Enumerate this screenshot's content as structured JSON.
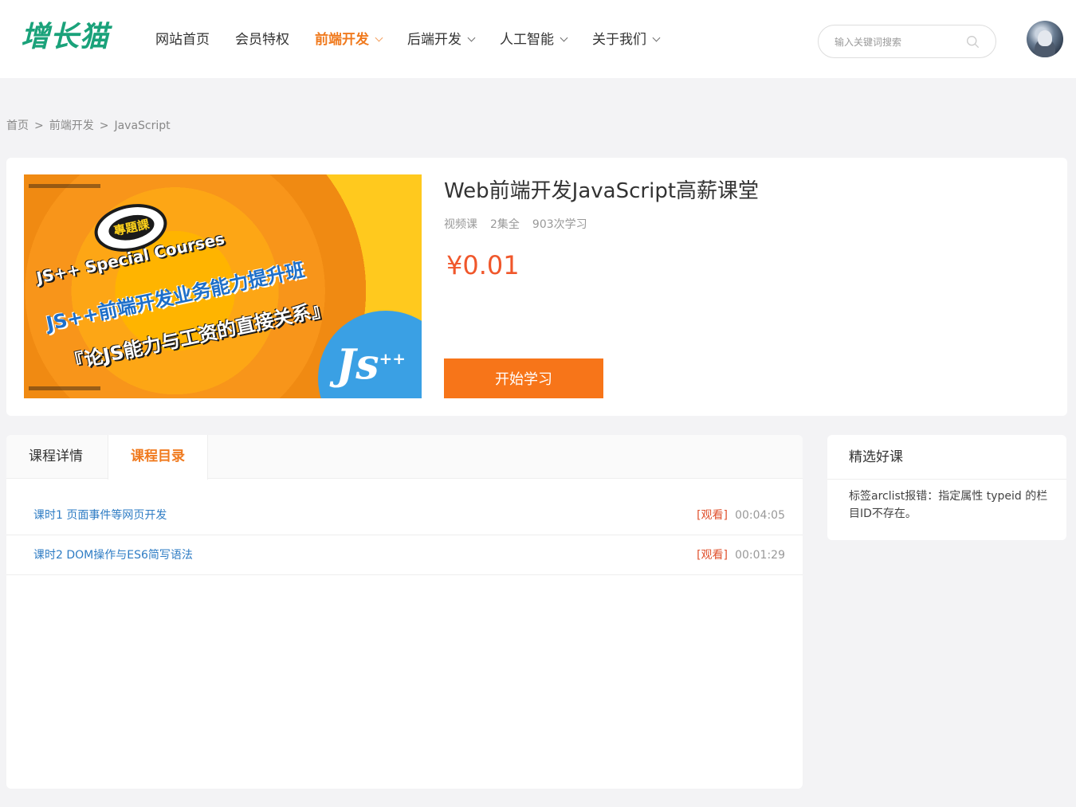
{
  "header": {
    "logo": "增长猫",
    "nav": [
      {
        "label": "网站首页"
      },
      {
        "label": "会员特权"
      },
      {
        "label": "前端开发"
      },
      {
        "label": "后端开发"
      },
      {
        "label": "人工智能"
      },
      {
        "label": "关于我们"
      }
    ],
    "search": {
      "placeholder": "输入关键词搜索",
      "icon": "search-icon"
    }
  },
  "breadcrumb": [
    "首页",
    "前端开发",
    "JavaScript"
  ],
  "breadcrumb_sep": ">",
  "course": {
    "cover": {
      "bubble": "專題課",
      "line1": "JS++ Special Courses",
      "line2": "JS++前端开发业务能力提升班",
      "line3": "『论JS能力与工资的直接关系』",
      "logo": "Js",
      "logo_sup": "++"
    },
    "title": "Web前端开发JavaScript高薪课堂",
    "meta": [
      "视频课",
      "2集全",
      "903次学习"
    ],
    "price": "¥0.01",
    "start_label": "开始学习",
    "accent_color": "#f77519"
  },
  "tabs": [
    {
      "label": "课程详情"
    },
    {
      "label": "课程目录"
    }
  ],
  "lessons": [
    {
      "name": "课时1  页面事件等网页开发",
      "watch": "[观看]",
      "duration": "00:04:05"
    },
    {
      "name": "课时2  DOM操作与ES6简写语法",
      "watch": "[观看]",
      "duration": "00:01:29"
    }
  ],
  "side": {
    "title": "精选好课",
    "body": "标签arclist报错：指定属性 typeid 的栏目ID不存在。"
  }
}
